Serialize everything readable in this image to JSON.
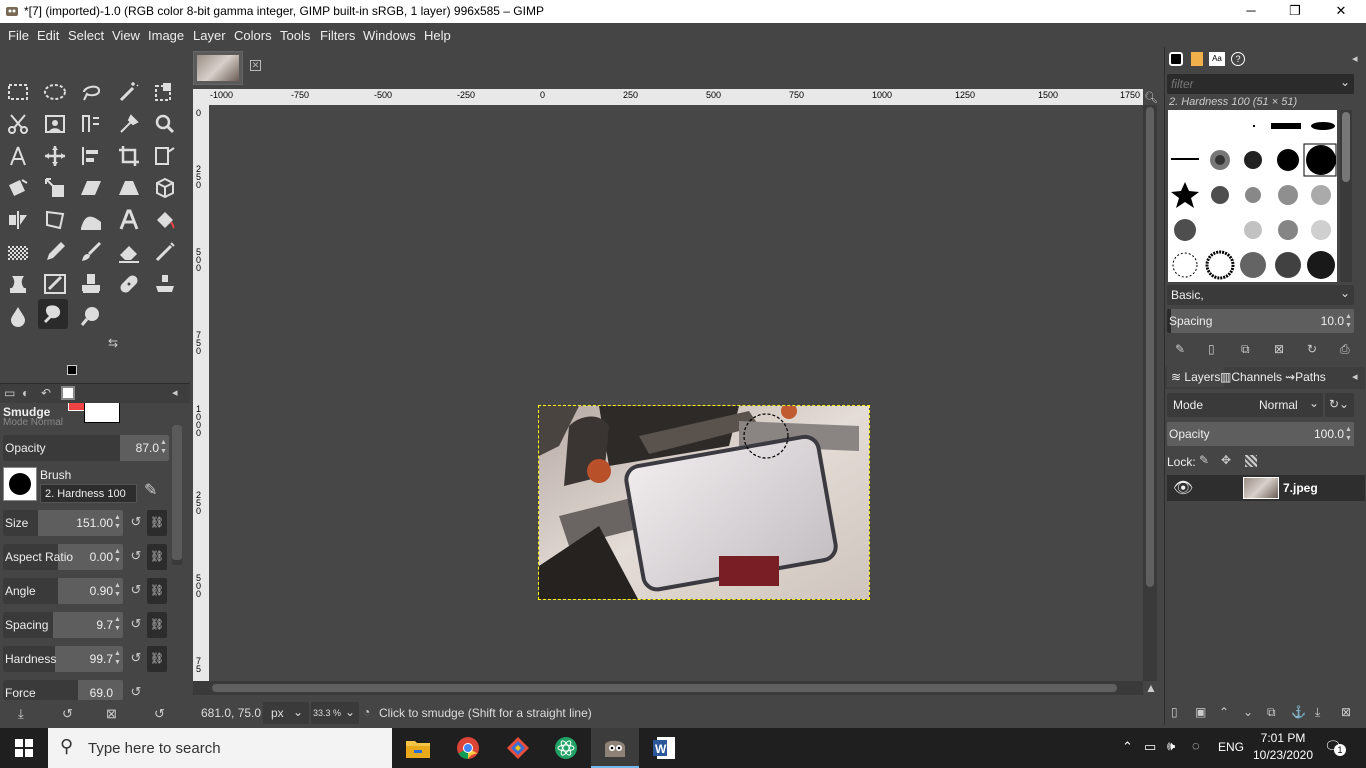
{
  "window": {
    "title": "*[7] (imported)-1.0 (RGB color 8-bit gamma integer, GIMP built-in sRGB, 1 layer) 996x585 – GIMP",
    "minimize": "─",
    "maximize": "❐",
    "close": "✕"
  },
  "menu": [
    "File",
    "Edit",
    "Select",
    "View",
    "Image",
    "Layer",
    "Colors",
    "Tools",
    "Filters",
    "Windows",
    "Help"
  ],
  "tools": [
    "rect-select",
    "ellipse-select",
    "free-select",
    "fuzzy-select",
    "select-by-color",
    "scissors-select",
    "foreground-select",
    "paths",
    "color-picker",
    "zoom",
    "measure",
    "move",
    "align",
    "crop",
    "unified-transform",
    "rotate",
    "scale",
    "shear",
    "perspective",
    "3d-transform",
    "flip",
    "cage-transform",
    "warp-transform",
    "text",
    "bucket-fill",
    "gradient",
    "pencil",
    "paintbrush",
    "eraser",
    "airbrush",
    "ink",
    "mypaint-brush",
    "clone",
    "heal",
    "perspective-clone",
    "blur-sharpen",
    "smudge",
    "dodge-burn"
  ],
  "colors": {
    "foreground": "#f04444",
    "background": "#ffffff",
    "accent": "#76b9ed"
  },
  "tool_options": {
    "name": "Smudge",
    "mode_hidden": "Mode    Normal",
    "opacity_label": "Opacity",
    "opacity_value": "87.0",
    "opacity_frac": 0.87,
    "brush_label": "Brush",
    "brush_name": "2. Hardness 100",
    "size_label": "Size",
    "size_value": "151.00",
    "aspect_label": "Aspect Ratio",
    "aspect_value": "0.00",
    "angle_label": "Angle",
    "angle_value": "0.90",
    "spacing_label": "Spacing",
    "spacing_value": "9.7",
    "hardness_label": "Hardness",
    "hardness_value": "99.7",
    "force_label": "Force",
    "force_value": "69.0"
  },
  "rulers": {
    "h_ticks": [
      "-1000",
      "-750",
      "-500",
      "-250",
      "0",
      "250",
      "500",
      "750",
      "1000",
      "1250",
      "1500",
      "1750"
    ],
    "v_ticks": [
      "0",
      "2 5 0",
      "5 0 0",
      "7 5 0",
      "1 0 0 0",
      "0",
      "2 5 0",
      "5 0 0",
      "7 5"
    ]
  },
  "status": {
    "coords": "681.0, 75.0",
    "unit": "px",
    "zoom": "33.3 %",
    "message": "Click to smudge (Shift for a straight line)"
  },
  "brushes_panel": {
    "filter_placeholder": "filter",
    "selected": "2. Hardness 100 (51 × 51)",
    "preset": "Basic,",
    "spacing_label": "Spacing",
    "spacing_value": "10.0"
  },
  "layers_panel": {
    "tabs": [
      "Layers",
      "Channels",
      "Paths"
    ],
    "mode_label": "Mode",
    "mode_value": "Normal",
    "opacity_label": "Opacity",
    "opacity_value": "100.0",
    "lock_label": "Lock:",
    "layer_name": "7.jpeg"
  },
  "taskbar": {
    "search_placeholder": "Type here to search",
    "language": "ENG",
    "time": "7:01 PM",
    "date": "10/23/2020",
    "notifications": "1"
  }
}
